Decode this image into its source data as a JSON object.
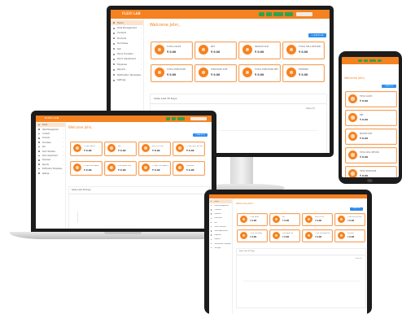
{
  "app": {
    "logo_text": "FLEXI LAB",
    "welcome": "Welcome John,",
    "new_button": "+ Add to lst",
    "user_label": "User Admin"
  },
  "sidebar_items": [
    "Home",
    "Data Management",
    "Contacts",
    "Products",
    "Purchases",
    "Sell",
    "Stock Transfers",
    "Stock Adjustment",
    "Expenses",
    "Reports",
    "Notification Templates",
    "Settings"
  ],
  "cards": [
    {
      "label": "TOTAL SALES",
      "value": "₹ 0.00"
    },
    {
      "label": "NET",
      "value": "₹ 0.00"
    },
    {
      "label": "INVOICE DUE",
      "value": "₹ 0.00"
    },
    {
      "label": "TOTAL SELL RETURN",
      "value": "₹ 0.00"
    },
    {
      "label": "TOTAL PURCHASE",
      "value": "₹ 0.00"
    },
    {
      "label": "PURCHASE DUE",
      "value": "₹ 0.00"
    },
    {
      "label": "TOTAL PURCHASE RETURN",
      "value": "₹ 0.00"
    },
    {
      "label": "EXPENSE",
      "value": "₹ 0.00"
    }
  ],
  "chart": {
    "title": "Sales Last 30 Days",
    "legend": "Sales (₹)"
  },
  "colors": {
    "brand": "#f58220",
    "success": "#2fa34c",
    "primary": "#2e8ef0"
  },
  "icons": [
    "menu-icon",
    "bell-icon",
    "user-icon",
    "chart-icon",
    "cart-icon"
  ]
}
